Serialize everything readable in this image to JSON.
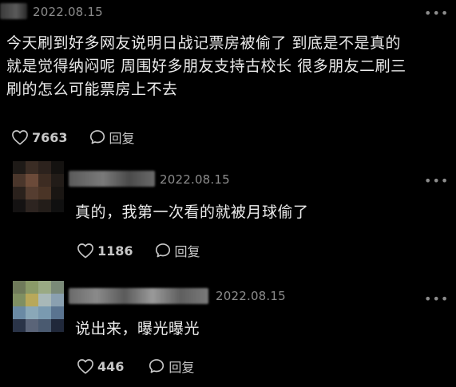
{
  "colors": {
    "background": "#000000",
    "text": "#eaeaea",
    "muted": "#8c8c8c",
    "action": "#c8c8c8"
  },
  "main_comment": {
    "date": "2022.08.15",
    "more_icon": "more-dots-icon",
    "lines": [
      "今天刷到好多网友说明日战记票房被偷了 到底是不是真的",
      "就是觉得纳闷呢 周围好多朋友支持古校长 很多朋友二刷三",
      "刷的怎么可能票房上不去"
    ],
    "like_icon": "heart-icon",
    "likes": "7663",
    "reply_icon": "comment-bubble-icon",
    "reply_label": "回复"
  },
  "replies": [
    {
      "date": "2022.08.15",
      "more_icon": "more-dots-icon",
      "text": "真的，我第一次看的就被月球偷了",
      "like_icon": "heart-icon",
      "likes": "1186",
      "reply_icon": "comment-bubble-icon",
      "reply_label": "回复"
    },
    {
      "date": "2022.08.15",
      "more_icon": "more-dots-icon",
      "text": "说出来，曝光曝光",
      "like_icon": "heart-icon",
      "likes": "446",
      "reply_icon": "comment-bubble-icon",
      "reply_label": "回复"
    }
  ]
}
